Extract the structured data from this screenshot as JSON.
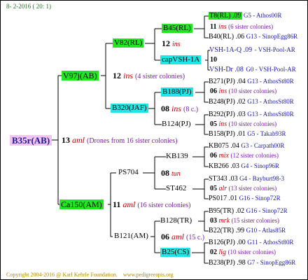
{
  "header": {
    "date": "8- 2-2016 ( 20: 1)"
  },
  "footer": {
    "copyright": "Copyright 2004-2016 @ Karl Kehrle Foundation.",
    "site": "www.pedigreeapis.org"
  },
  "root": {
    "name": "B35r(AB)",
    "num": "13",
    "abbr": "aml",
    "note": "(Drones from 16 sister colonies)"
  },
  "gen1": [
    {
      "name": "V97j(AB)",
      "num": "12",
      "abbr": "ins",
      "note": "(4 sister colonies)"
    },
    {
      "name": "Ca150(AM)",
      "num": "11",
      "abbr": "aml",
      "note": "(16 sister colonies)"
    }
  ],
  "gen2": [
    {
      "name": "V82(RL)"
    },
    {
      "name": "B320(JAF)",
      "num": "08",
      "abbr": "ins",
      "note": "(8 c.)"
    },
    {
      "name": "PS704",
      "num": "08",
      "abbr": "tun"
    },
    {
      "name": "B121(AM)",
      "num": "06",
      "abbr": "aml",
      "note": "(15 c.)"
    }
  ],
  "gen3": [
    {
      "name": "B45(RL)",
      "num": "12",
      "abbr": "ins"
    },
    {
      "name": "capVSH-1A",
      "num": "10"
    },
    {
      "name": "B188(PJ)"
    },
    {
      "name": "B124(PJ)"
    },
    {
      "name": "KB139"
    },
    {
      "name": "ST462"
    },
    {
      "name": "B128(TR)"
    },
    {
      "name": "B25(CS)"
    }
  ],
  "gen4": [
    {
      "left": "T8(RL) .09",
      "right": "G5 - Athos00R"
    },
    {
      "num": "11",
      "abbr": "ins",
      "note": "(6 sister colonies)"
    },
    {
      "left": "B40(RL) .06",
      "right": "G13 - SinopEgg86R"
    },
    {
      "left": "VSH-1A-Q .09",
      "right": "- VSH-Pool-AR"
    },
    {
      "left": "VSH-Dr .08",
      "right": "G0 - VSH-Pool-AR"
    },
    {
      "left": "B271(PJ) .04",
      "right": "G13 - AthosSt80R"
    },
    {
      "num": "06",
      "abbr": "ins",
      "note": "(10 sister colonies)"
    },
    {
      "left": "B248(PJ) .02",
      "right": "G13 - AthosSt80R"
    },
    {
      "left": "B292(PJ) .03",
      "right": "G13 - AthosSt80R"
    },
    {
      "num": "05",
      "abbr": "ins",
      "note": "(10 sister colonies)"
    },
    {
      "left": "B158(PJ) .01",
      "right": "G5 - Takab93R"
    },
    {
      "left": "KB075 .04",
      "right": "G3 - Carpath00R"
    },
    {
      "num": "06",
      "abbr": "mix",
      "note": "(12 sister colonies)"
    },
    {
      "left": "KB266 .03",
      "right": "G4 - Sinop96R"
    },
    {
      "left": "ST343 .03",
      "right": "G4 - Bayburt98-3"
    },
    {
      "num": "05",
      "abbr": "alr",
      "note": "(13 sister colonies)"
    },
    {
      "left": "PS017 .01",
      "right": "G16 - Sinop72R"
    },
    {
      "left": "B95(TR) .02",
      "right": "G16 - Sinop72R"
    },
    {
      "num": "03",
      "abbr": "mrk",
      "note": "(15 sister colonies)"
    },
    {
      "left": "B22(TR) .99",
      "right": "G10 - Atlas85R"
    },
    {
      "left": "B126(PJ) .00",
      "right": "G11 - AthosSt80R"
    },
    {
      "num": "02",
      "abbr": "lig",
      "note": "(10 sister colonies)"
    },
    {
      "left": "B238(PJ) .98",
      "right": "G7 - SinopEgg86R"
    }
  ]
}
